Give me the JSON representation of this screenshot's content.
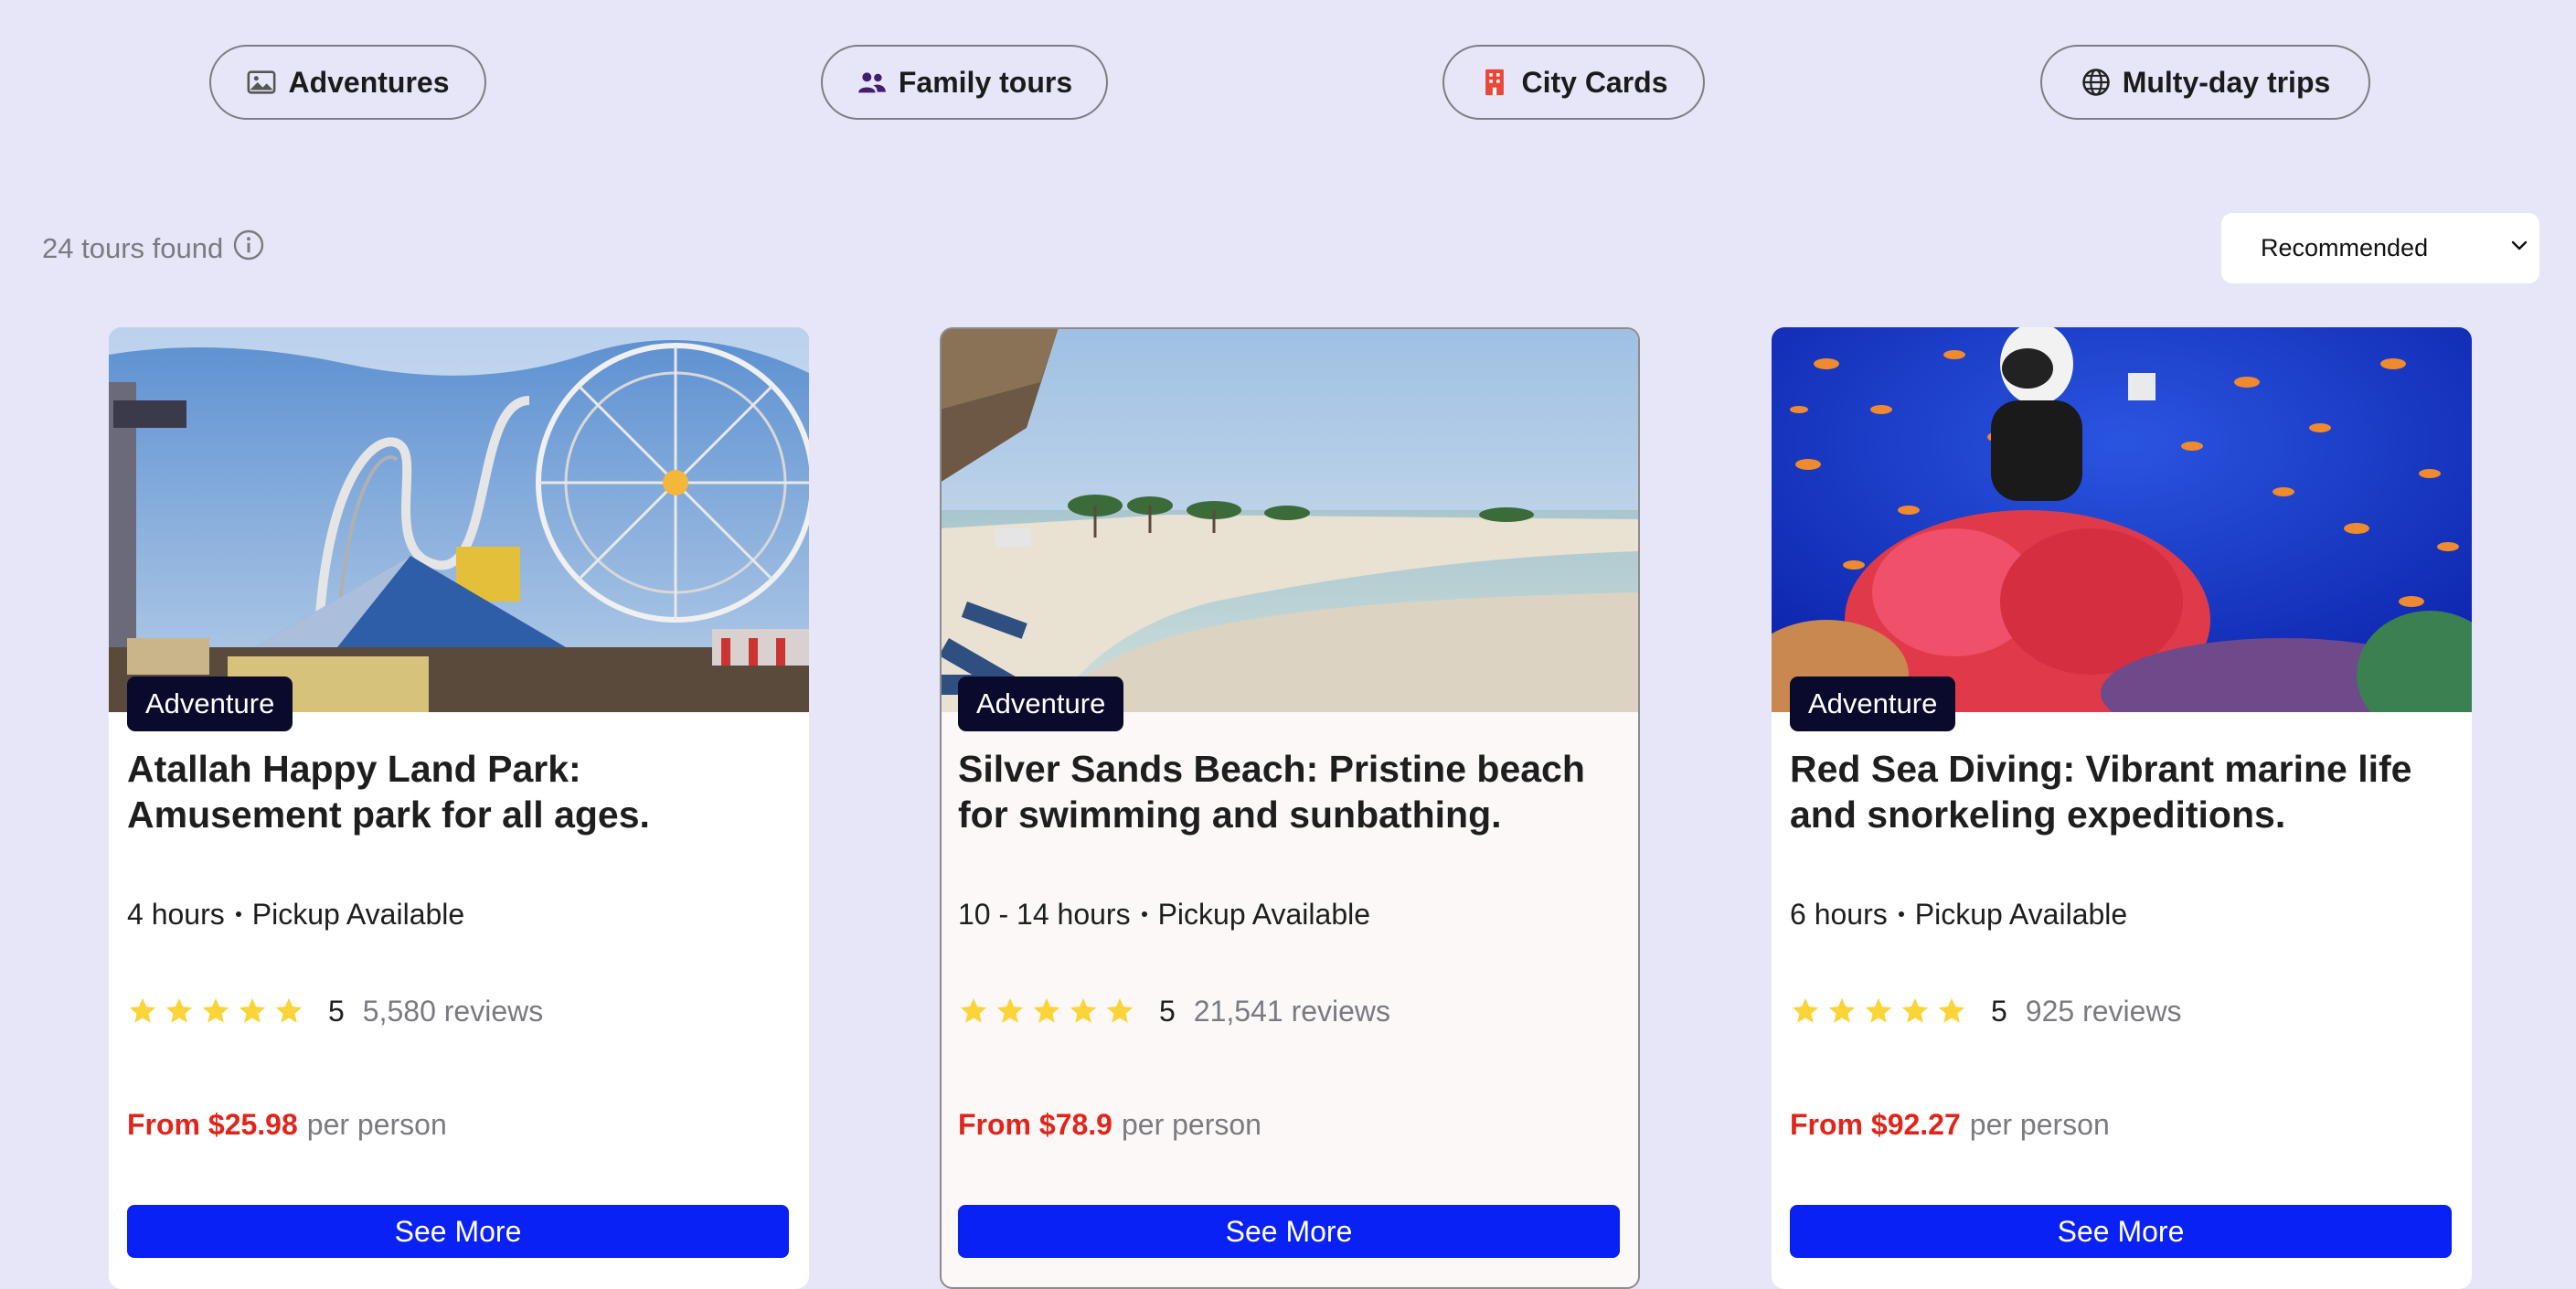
{
  "categories": [
    {
      "label": "Adventures",
      "icon": "image-icon"
    },
    {
      "label": "Family tours",
      "icon": "people-icon"
    },
    {
      "label": "City Cards",
      "icon": "building-icon"
    },
    {
      "label": "Multy-day trips",
      "icon": "globe-icon"
    }
  ],
  "results": {
    "count_text": "24 tours found",
    "info_icon": "info-icon"
  },
  "sort": {
    "selected": "Recommended"
  },
  "cards": [
    {
      "badge": "Adventure",
      "title": "Atallah Happy Land Park: Amusement park for all ages.",
      "duration": "4 hours",
      "pickup": "Pickup Available",
      "rating": 5,
      "score": "5",
      "reviews": "5,580 reviews",
      "price_from": "From $25.98",
      "price_per": "per person",
      "button": "See More",
      "image": "amusement-park-photo"
    },
    {
      "badge": "Adventure",
      "title": "Silver Sands Beach: Pristine beach for swimming and sunbathing.",
      "duration": "10 - 14 hours",
      "pickup": "Pickup Available",
      "rating": 5,
      "score": "5",
      "reviews": "21,541 reviews",
      "price_from": "From $78.9",
      "price_per": "per person",
      "button": "See More",
      "image": "beach-photo"
    },
    {
      "badge": "Adventure",
      "title": "Red Sea Diving: Vibrant marine life and snorkeling expeditions.",
      "duration": "6 hours",
      "pickup": "Pickup Available",
      "rating": 5,
      "score": "5",
      "reviews": "925 reviews",
      "price_from": "From $92.27",
      "price_per": "per person",
      "button": "See More",
      "image": "coral-reef-diving-photo"
    }
  ],
  "colors": {
    "background": "#e7e6f8",
    "badge": "#0a0a2c",
    "button": "#0a21f5",
    "price": "#e1251b",
    "star": "#fbd43a"
  }
}
